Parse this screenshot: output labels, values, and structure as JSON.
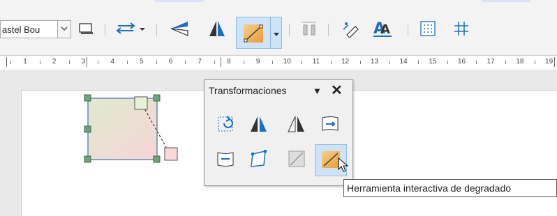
{
  "toolbar": {
    "style_box": {
      "value": "astel Bou"
    },
    "buttons": [
      {
        "id": "shadow",
        "icon": "shadow-icon"
      },
      {
        "id": "transformations",
        "icon": "transformations-icon"
      },
      {
        "id": "flip-vertical",
        "icon": "flip-vertical-icon"
      },
      {
        "id": "flip-horizontal",
        "icon": "flip-horizontal-icon"
      },
      {
        "id": "gradient-tool",
        "icon": "gradient-tool-icon"
      },
      {
        "id": "distribute",
        "icon": "distribute-icon"
      },
      {
        "id": "glue-points",
        "icon": "glue-points-icon"
      },
      {
        "id": "fontwork",
        "icon": "fontwork-icon"
      },
      {
        "id": "show-grid",
        "icon": "grid-icon"
      },
      {
        "id": "snap-grid",
        "icon": "snap-grid-icon"
      }
    ]
  },
  "ruler": {
    "numbers": [
      "1",
      "2",
      "3",
      "4",
      "5",
      "6",
      "7",
      "8",
      "9",
      "10",
      "11",
      "12",
      "13",
      "14",
      "15",
      "16",
      "17",
      "18",
      "19"
    ]
  },
  "panel": {
    "title": "Transformaciones",
    "menu_arrow": "▼",
    "close": "✕",
    "buttons": [
      {
        "icon": "rotate-icon"
      },
      {
        "icon": "flip-icon"
      },
      {
        "icon": "set-in-circle-perspective-icon"
      },
      {
        "icon": "set-in-circle-slant-icon"
      },
      {
        "icon": "set-to-circle-icon"
      },
      {
        "icon": "distort-icon"
      },
      {
        "icon": "transparency-tool-icon"
      },
      {
        "icon": "interactive-gradient-icon",
        "selected": true
      }
    ]
  },
  "tooltip": {
    "text": "Herramienta interactiva de degradado"
  },
  "colors": {
    "accent_bg": "#cfe3f7",
    "accent_border": "#8fbbe6",
    "handle_green": "#6fa37a",
    "shape_border": "#3d6fb6"
  }
}
